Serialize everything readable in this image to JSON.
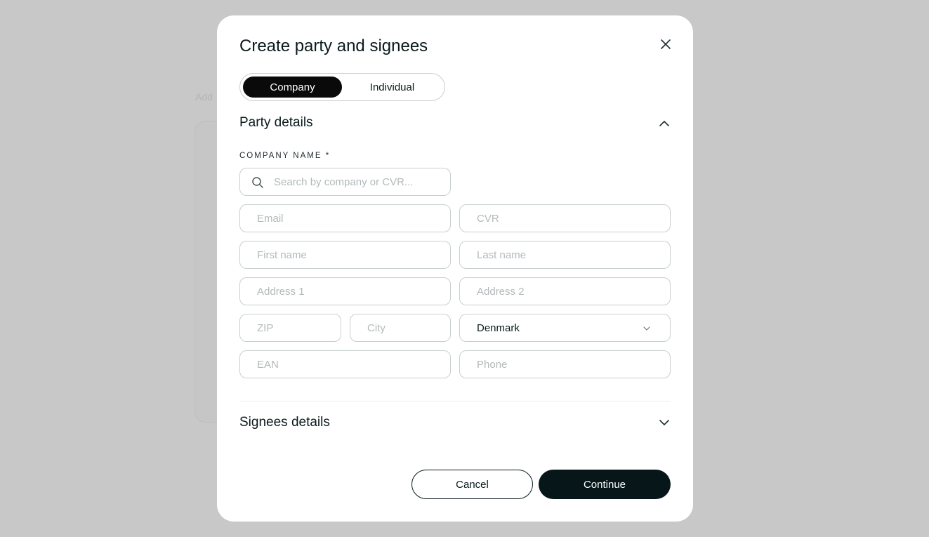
{
  "background": {
    "label": "Add"
  },
  "modal": {
    "title": "Create party and signees",
    "close_icon": "close-icon"
  },
  "party_type_toggle": {
    "options": [
      "Company",
      "Individual"
    ],
    "selected": "Company"
  },
  "party_details": {
    "title": "Party details",
    "expanded": true,
    "company_name_label": "COMPANY NAME *",
    "search_placeholder": "Search by company or CVR...",
    "fields": {
      "email": "Email",
      "cvr": "CVR",
      "first_name": "First name",
      "last_name": "Last name",
      "address1": "Address 1",
      "address2": "Address 2",
      "zip": "ZIP",
      "city": "City",
      "country": "Denmark",
      "ean": "EAN",
      "phone": "Phone"
    }
  },
  "signees_details": {
    "title": "Signees details",
    "expanded": false
  },
  "actions": {
    "cancel": "Cancel",
    "continue": "Continue"
  },
  "colors": {
    "overlay": "#c8c8c8",
    "primary": "#061619",
    "border": "#c9cfd0",
    "placeholder": "#b3b9ba"
  }
}
